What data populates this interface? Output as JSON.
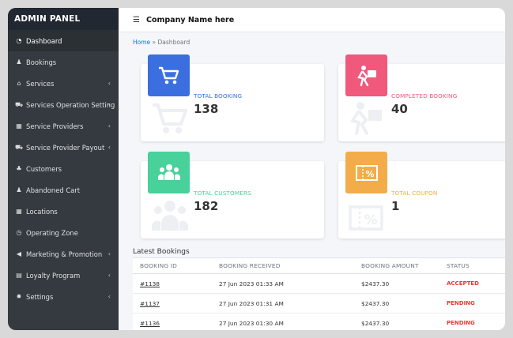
{
  "sidebar": {
    "brand": "ADMIN PANEL",
    "items": [
      {
        "icon": "dashboard-icon",
        "glyph": "◔",
        "label": "Dashboard",
        "chevron": ""
      },
      {
        "icon": "bookings-icon",
        "glyph": "♟",
        "label": "Bookings",
        "chevron": ""
      },
      {
        "icon": "services-icon",
        "glyph": "⌂",
        "label": "Services",
        "chevron": "‹"
      },
      {
        "icon": "cart-icon",
        "glyph": "⛟",
        "label": "Services Operation Setting",
        "chevron": "‹"
      },
      {
        "icon": "table-icon",
        "glyph": "▦",
        "label": "Service Providers",
        "chevron": "‹"
      },
      {
        "icon": "cart-icon",
        "glyph": "⛟",
        "label": "Service Provider Payout",
        "chevron": "‹"
      },
      {
        "icon": "users-icon",
        "glyph": "♣",
        "label": "Customers",
        "chevron": ""
      },
      {
        "icon": "user-icon",
        "glyph": "♟",
        "label": "Abandoned Cart",
        "chevron": ""
      },
      {
        "icon": "table-icon",
        "glyph": "▦",
        "label": "Locations",
        "chevron": ""
      },
      {
        "icon": "clock-icon",
        "glyph": "◷",
        "label": "Operating Zone",
        "chevron": ""
      },
      {
        "icon": "megaphone-icon",
        "glyph": "◀",
        "label": "Marketing & Promotion",
        "chevron": "‹"
      },
      {
        "icon": "book-icon",
        "glyph": "▤",
        "label": "Loyalty Program",
        "chevron": "‹"
      },
      {
        "icon": "gear-icon",
        "glyph": "✹",
        "label": "Settings",
        "chevron": "‹"
      }
    ]
  },
  "header": {
    "company": "Company Name here"
  },
  "breadcrumb": {
    "home": "Home",
    "separator": "»",
    "current": "Dashboard"
  },
  "cards": [
    {
      "label": "TOTAL BOOKING",
      "value": "138",
      "color": "#3b6fe0"
    },
    {
      "label": "COMPLETED BOOKING",
      "value": "40",
      "color": "#f0587c"
    },
    {
      "label": "TOTAL CUSTOMERS",
      "value": "182",
      "color": "#48d19a"
    },
    {
      "label": "TOTAL COUPON",
      "value": "1",
      "color": "#f2ad4a"
    }
  ],
  "latest": {
    "title": "Latest Bookings",
    "columns": [
      "BOOKING ID",
      "BOOKING RECEIVED",
      "BOOKING AMOUNT",
      "STATUS"
    ],
    "rows": [
      {
        "id": "#1138",
        "received": "27 Jun 2023 01:33 AM",
        "amount": "$2437.30",
        "status": "ACCEPTED",
        "status_color": "#e53935"
      },
      {
        "id": "#1137",
        "received": "27 Jun 2023 01:31 AM",
        "amount": "$2437.30",
        "status": "PENDING",
        "status_color": "#e53935"
      },
      {
        "id": "#1136",
        "received": "27 Jun 2023 01:30 AM",
        "amount": "$2437.30",
        "status": "PENDING",
        "status_color": "#e53935"
      }
    ]
  }
}
